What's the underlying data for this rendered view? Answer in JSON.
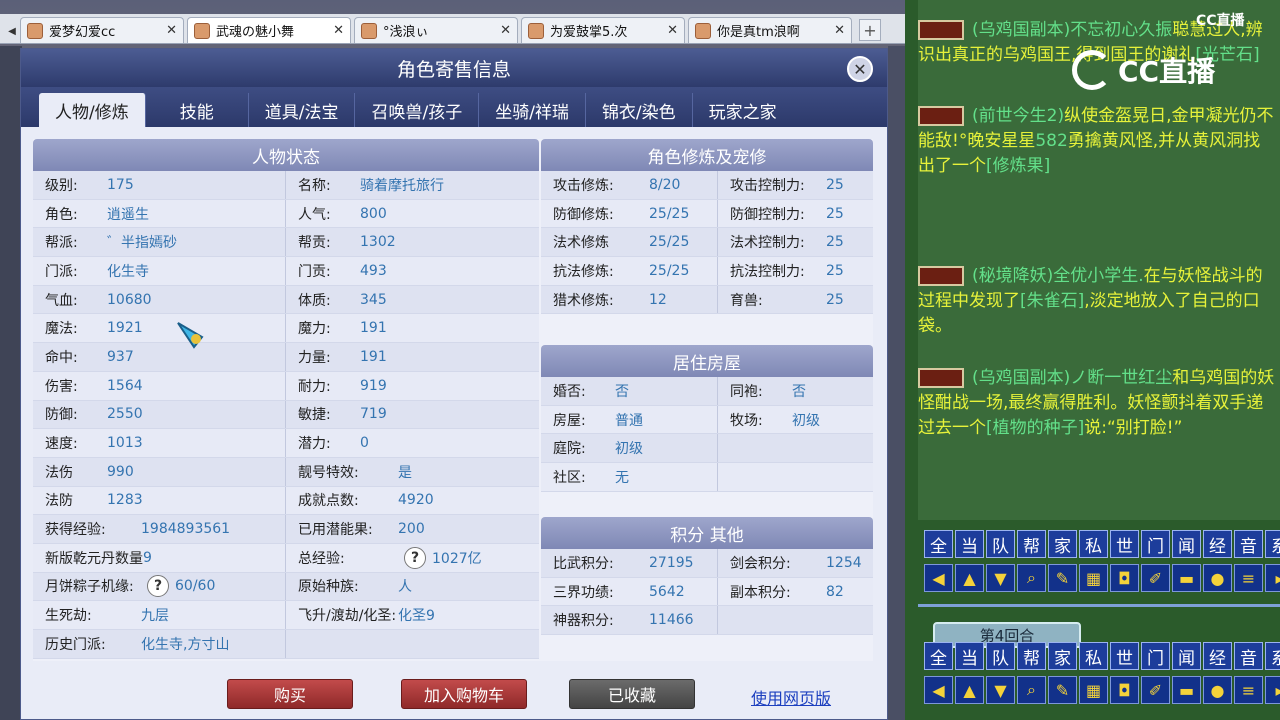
{
  "browser_tabs": [
    {
      "label": "爱梦幻爱cc"
    },
    {
      "label": "武魂の魅小舞"
    },
    {
      "label": "°浅浪ぃ"
    },
    {
      "label": "为爱鼓掌5.次"
    },
    {
      "label": "你是真tm浪啊"
    }
  ],
  "modal": {
    "title": "角色寄售信息",
    "tabs": [
      "人物/修炼",
      "技能",
      "道具/法宝",
      "召唤兽/孩子",
      "坐骑/祥瑞",
      "锦衣/染色",
      "玩家之家"
    ]
  },
  "status_panel": {
    "title": "人物状态",
    "rows": [
      [
        {
          "k": "级别:",
          "v": "175"
        },
        {
          "k": "名称:",
          "v": "骑着摩托旅行"
        }
      ],
      [
        {
          "k": "角色:",
          "v": "逍遥生"
        },
        {
          "k": "人气:",
          "v": "800"
        }
      ],
      [
        {
          "k": "帮派:",
          "v": "゛半指嫣砂"
        },
        {
          "k": "帮贡:",
          "v": "1302"
        }
      ],
      [
        {
          "k": "门派:",
          "v": "化生寺"
        },
        {
          "k": "门贡:",
          "v": "493"
        }
      ],
      [
        {
          "k": "气血:",
          "v": "10680"
        },
        {
          "k": "体质:",
          "v": "345"
        }
      ],
      [
        {
          "k": "魔法:",
          "v": "1921"
        },
        {
          "k": "魔力:",
          "v": "191"
        }
      ],
      [
        {
          "k": "命中:",
          "v": "937"
        },
        {
          "k": "力量:",
          "v": "191"
        }
      ],
      [
        {
          "k": "伤害:",
          "v": "1564"
        },
        {
          "k": "耐力:",
          "v": "919"
        }
      ],
      [
        {
          "k": "防御:",
          "v": "2550"
        },
        {
          "k": "敏捷:",
          "v": "719"
        }
      ],
      [
        {
          "k": "速度:",
          "v": "1013"
        },
        {
          "k": "潜力:",
          "v": "0"
        }
      ],
      [
        {
          "k": "法伤",
          "v": "990"
        },
        {
          "k": "靓号特效:",
          "v": "是"
        }
      ],
      [
        {
          "k": "法防",
          "v": "1283"
        },
        {
          "k": "成就点数:",
          "v": "4920"
        }
      ],
      [
        {
          "k": "获得经验:",
          "v": "1984893561"
        },
        {
          "k": "已用潜能果:",
          "v": "200"
        }
      ],
      [
        {
          "k": "新版乾元丹数量",
          "v": "9"
        },
        {
          "k": "总经验:",
          "v": "1027亿"
        }
      ],
      [
        {
          "k": "月饼粽子机缘:",
          "v": "60/60"
        },
        {
          "k": "原始种族:",
          "v": "人"
        }
      ],
      [
        {
          "k": "生死劫:",
          "v": "九层"
        },
        {
          "k": "飞升/渡劫/化圣:",
          "v": "化圣9"
        }
      ],
      [
        {
          "k": "历史门派:",
          "v": "化生寺,方寸山"
        },
        {
          "k": "",
          "v": ""
        }
      ]
    ]
  },
  "cultivation_panel": {
    "title": "角色修炼及宠修",
    "rows": [
      [
        {
          "k": "攻击修炼:",
          "v": "8/20"
        },
        {
          "k": "攻击控制力:",
          "v": "25"
        }
      ],
      [
        {
          "k": "防御修炼:",
          "v": "25/25"
        },
        {
          "k": "防御控制力:",
          "v": "25"
        }
      ],
      [
        {
          "k": "法术修炼",
          "v": "25/25"
        },
        {
          "k": "法术控制力:",
          "v": "25"
        }
      ],
      [
        {
          "k": "抗法修炼:",
          "v": "25/25"
        },
        {
          "k": "抗法控制力:",
          "v": "25"
        }
      ],
      [
        {
          "k": "猎术修炼:",
          "v": "12"
        },
        {
          "k": "育兽:",
          "v": "25"
        }
      ]
    ]
  },
  "housing_panel": {
    "title": "居住房屋",
    "rows": [
      [
        {
          "k": "婚否:",
          "v": "否"
        },
        {
          "k": "同袍:",
          "v": "否"
        }
      ],
      [
        {
          "k": "房屋:",
          "v": "普通"
        },
        {
          "k": "牧场:",
          "v": "初级"
        }
      ],
      [
        {
          "k": "庭院:",
          "v": "初级"
        },
        {
          "k": "",
          "v": ""
        }
      ],
      [
        {
          "k": "社区:",
          "v": "无"
        },
        {
          "k": "",
          "v": ""
        }
      ]
    ]
  },
  "points_panel": {
    "title": "积分 其他",
    "rows": [
      [
        {
          "k": "比武积分:",
          "v": "27195"
        },
        {
          "k": "剑会积分:",
          "v": "1254"
        }
      ],
      [
        {
          "k": "三界功绩:",
          "v": "5642"
        },
        {
          "k": "副本积分:",
          "v": "82"
        }
      ],
      [
        {
          "k": "神器积分:",
          "v": "11466"
        },
        {
          "k": "",
          "v": ""
        }
      ]
    ]
  },
  "footer": {
    "buy": "购买",
    "add_cart": "加入购物车",
    "favorited": "已收藏",
    "web_version": "使用网页版"
  },
  "chat": {
    "msg1_pre": "(乌鸡国副本)",
    "msg1_name": "不忘初心久振",
    "msg1_text": "聪慧过人,辨识出真正的乌鸡国王,得到国王的谢礼",
    "msg1_item": "[光芒石]",
    "msg2_pre": "(前世今生2)",
    "msg2_text": "纵使金盔晃日,金甲凝光仍不能敌!°晚安星星",
    "msg2_tail": "582",
    "msg2_text2": "勇擒黄风怪,并从黄风洞找出了一个",
    "msg2_item": "[修炼果]",
    "msg3_pre": "(秘境降妖)",
    "msg3_name": "全优小学生.",
    "msg3_text": "在与妖怪战斗的过程中发现了",
    "msg3_item": "[朱雀石]",
    "msg3_text2": ",淡定地放入了自己的口袋。",
    "msg4_pre": "(乌鸡国副本)",
    "msg4_name": "ノ断一世红尘",
    "msg4_text": "和乌鸡国的妖怪酣战一场,最终赢得胜利。妖怪颤抖着双手递过去一个",
    "msg4_item": "[植物的种子]",
    "msg4_text2": "说:“别打脸!”",
    "quick_channels": [
      "全",
      "当",
      "队",
      "帮",
      "家",
      "私",
      "世",
      "门",
      "闻",
      "经",
      "音",
      "系"
    ],
    "round_label": "第4回合",
    "logo_big": "CC直播",
    "logo_small": "CC直播"
  }
}
